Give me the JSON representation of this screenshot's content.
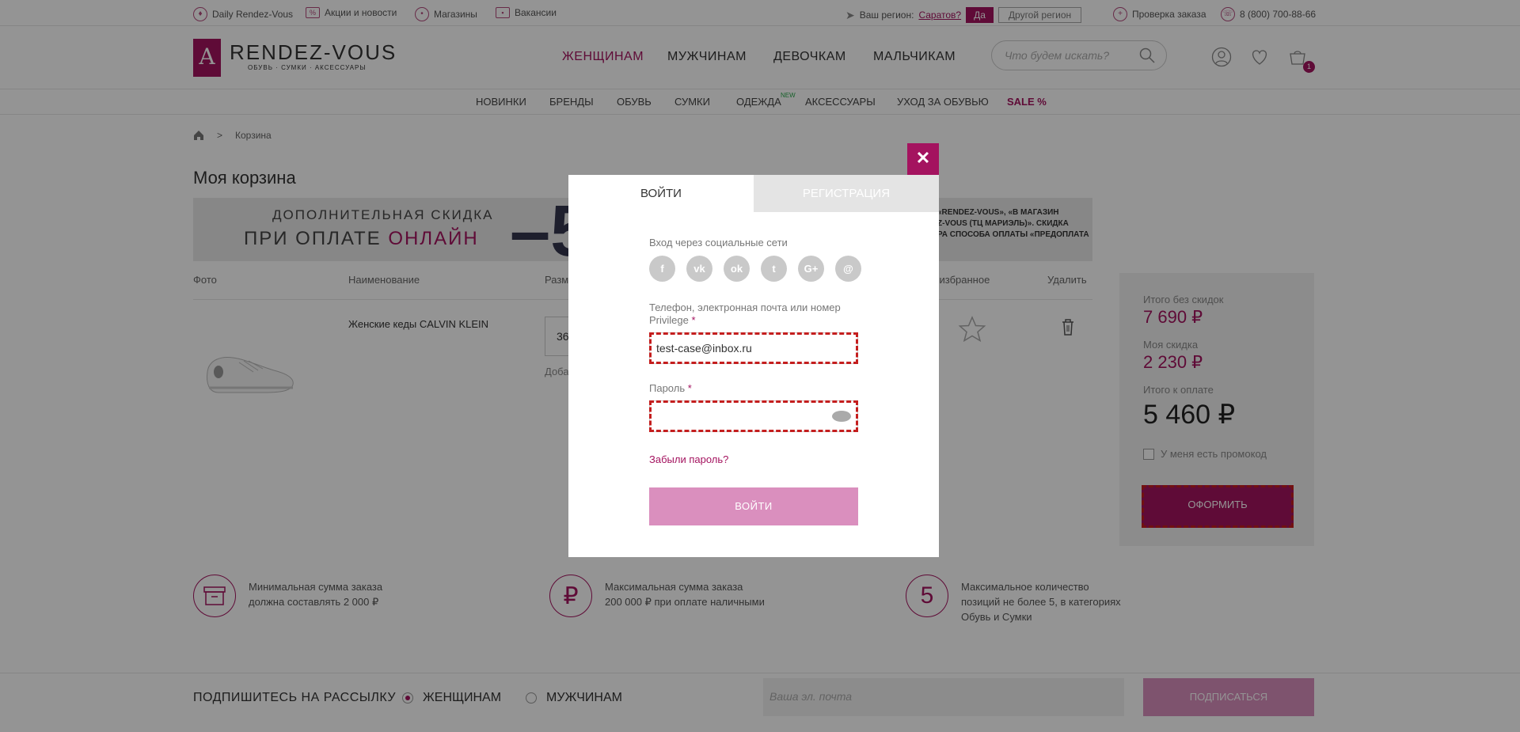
{
  "topbar": {
    "daily": "Daily Rendez-Vous",
    "promos": "Акции и новости",
    "stores": "Магазины",
    "jobs": "Вакансии",
    "region_label": "Ваш регион:",
    "region_value": "Саратов?",
    "yes": "Да",
    "other_region": "Другой регион",
    "order_check": "Проверка заказа",
    "phone": "8 (800) 700-88-66"
  },
  "header": {
    "logo_name": "RENDEZ-VOUS",
    "logo_sub": "ОБУВЬ · СУМКИ · АКСЕССУАРЫ",
    "nav": [
      "ЖЕНЩИНАМ",
      "МУЖЧИНАМ",
      "ДЕВОЧКАМ",
      "МАЛЬЧИКАМ"
    ],
    "search_placeholder": "Что будем искать?",
    "cart_count": "1"
  },
  "subnav": {
    "items": [
      "НОВИНКИ",
      "БРЕНДЫ",
      "ОБУВЬ",
      "СУМКИ",
      "ОДЕЖДА",
      "АКСЕССУАРЫ",
      "УХОД ЗА ОБУВЬЮ",
      "SALE %"
    ],
    "new_badge": "NEW"
  },
  "breadcrumb": {
    "sep": ">",
    "current": "Корзина"
  },
  "page_title": "Моя корзина",
  "banner": {
    "line1": "ДОПОЛНИТЕЛЬНАЯ СКИДКА",
    "line2_prefix": "ПРИ ОПЛАТЕ",
    "line2_accent": "ОНЛАЙН",
    "big": "–5",
    "right_l1": "«RENDEZ-VOUS», «В МАГАЗИН",
    "right_l2": "Z-VOUS (ТЦ МАРИЭЛЬ)». СКИДКА",
    "right_l3": "РА СПОСОБА ОПЛАТЫ «ПРЕДОПЛАТА"
  },
  "table": {
    "headers": [
      "Фото",
      "Наименование",
      "Разм",
      "в избранное",
      "Удалить"
    ],
    "product_name": "Женские кеды CALVIN KLEIN",
    "size": "36",
    "add_text": "Доба"
  },
  "summary": {
    "no_discount_label": "Итого без скидок",
    "no_discount_value": "7 690 ₽",
    "discount_label": "Моя скидка",
    "discount_value": "2 230 ₽",
    "total_label": "Итого к оплате",
    "total_value": "5 460 ₽",
    "promo_label": "У меня есть промокод",
    "checkout": "ОФОРМИТЬ"
  },
  "info": [
    {
      "icon": "box-icon",
      "glyph": "▭",
      "text1": "Минимальная сумма заказа",
      "text2": "должна составлять 2 000 ₽",
      "text3": ""
    },
    {
      "icon": "ruble-icon",
      "glyph": "₽",
      "text1": "Максимальная сумма заказа",
      "text2": "200 000 ₽ при оплате наличными",
      "text3": ""
    },
    {
      "icon": "five-icon",
      "glyph": "5",
      "text1": "Максимальное количество",
      "text2": "позиций не более 5, в категориях",
      "text3": "Обувь и Сумки"
    }
  ],
  "footer": {
    "subscribe_label": "ПОДПИШИТЕСЬ НА РАССЫЛКУ",
    "women": "ЖЕНЩИНАМ",
    "men": "МУЖЧИНАМ",
    "email_placeholder": "Ваша эл. почта",
    "subscribe_btn": "ПОДПИСАТЬСЯ"
  },
  "modal": {
    "close": "✕",
    "tab_login": "ВОЙТИ",
    "tab_register": "РЕГИСТРАЦИЯ",
    "social_label": "Вход через социальные сети",
    "socials": [
      {
        "icon": "facebook-icon",
        "glyph": "f"
      },
      {
        "icon": "vk-icon",
        "glyph": "vk"
      },
      {
        "icon": "odnoklassniki-icon",
        "glyph": "ok"
      },
      {
        "icon": "twitter-icon",
        "glyph": "t"
      },
      {
        "icon": "google-plus-icon",
        "glyph": "G+"
      },
      {
        "icon": "mail-icon",
        "glyph": "@"
      }
    ],
    "login_label_l1": "Телефон, электронная почта или номер",
    "login_label_l2": "Privilege",
    "login_value": "test-case@inbox.ru",
    "password_label": "Пароль",
    "password_value": "",
    "required_mark": "*",
    "forgot": "Забыли пароль?",
    "submit": "ВОЙТИ"
  },
  "colors": {
    "brand": "#a4135f",
    "button_light": "#da8fbe",
    "error_outline": "#c41e1e"
  }
}
